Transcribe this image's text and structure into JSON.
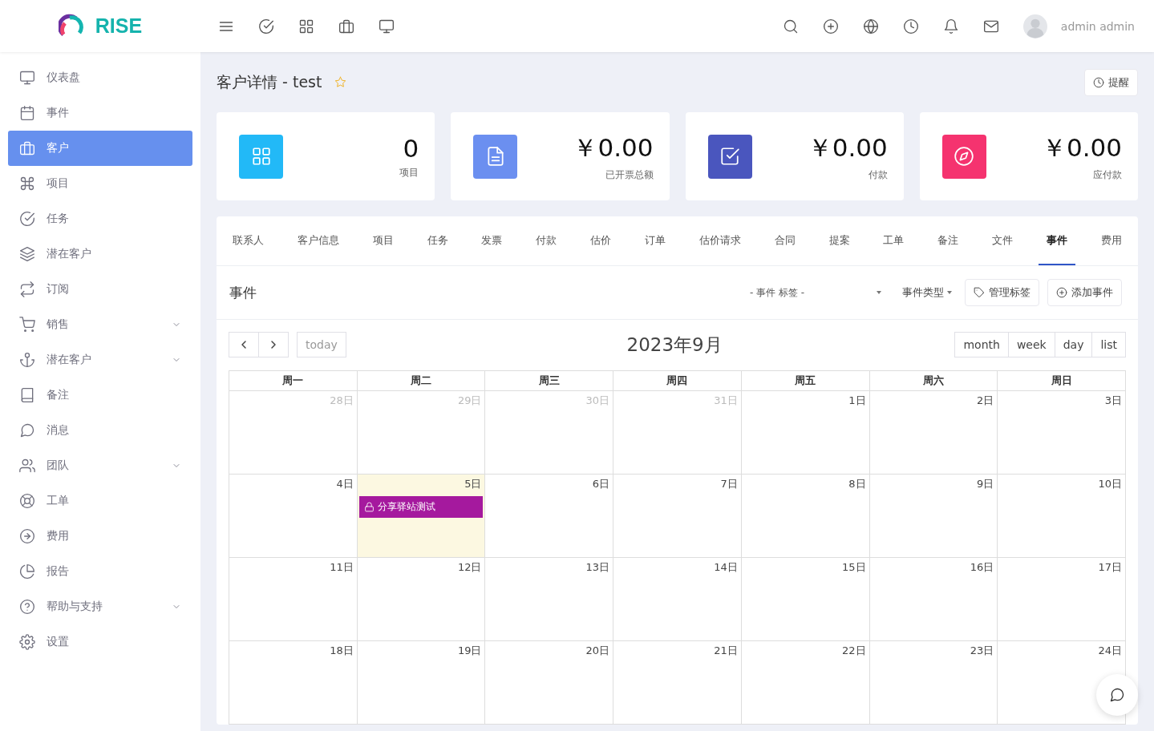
{
  "logo": {
    "text": "RISE"
  },
  "user": {
    "name": "admin admin"
  },
  "sidebar": {
    "items": [
      {
        "label": "仪表盘",
        "selected": false,
        "submenu": false
      },
      {
        "label": "事件",
        "selected": false,
        "submenu": false
      },
      {
        "label": "客户",
        "selected": true,
        "submenu": false
      },
      {
        "label": "项目",
        "selected": false,
        "submenu": false
      },
      {
        "label": "任务",
        "selected": false,
        "submenu": false
      },
      {
        "label": "潜在客户",
        "selected": false,
        "submenu": false
      },
      {
        "label": "订阅",
        "selected": false,
        "submenu": false
      },
      {
        "label": "销售",
        "selected": false,
        "submenu": true
      },
      {
        "label": "潜在客户",
        "selected": false,
        "submenu": true
      },
      {
        "label": "备注",
        "selected": false,
        "submenu": false
      },
      {
        "label": "消息",
        "selected": false,
        "submenu": false
      },
      {
        "label": "团队",
        "selected": false,
        "submenu": true
      },
      {
        "label": "工单",
        "selected": false,
        "submenu": false
      },
      {
        "label": "费用",
        "selected": false,
        "submenu": false
      },
      {
        "label": "报告",
        "selected": false,
        "submenu": false
      },
      {
        "label": "帮助与支持",
        "selected": false,
        "submenu": true
      },
      {
        "label": "设置",
        "selected": false,
        "submenu": false
      }
    ]
  },
  "page": {
    "title": "客户详情 - test",
    "starred": false,
    "reminder_button": "提醒"
  },
  "stats": [
    {
      "value": "0",
      "label": "项目",
      "color": "#22b9f7"
    },
    {
      "value": "￥0.00",
      "label": "已开票总额",
      "color": "#6b8ff0"
    },
    {
      "value": "￥0.00",
      "label": "付款",
      "color": "#4a56be"
    },
    {
      "value": "￥0.00",
      "label": "应付款",
      "color": "#f5336f"
    }
  ],
  "tabs": [
    {
      "label": "联系人",
      "selected": false
    },
    {
      "label": "客户信息",
      "selected": false
    },
    {
      "label": "项目",
      "selected": false
    },
    {
      "label": "任务",
      "selected": false
    },
    {
      "label": "发票",
      "selected": false
    },
    {
      "label": "付款",
      "selected": false
    },
    {
      "label": "估价",
      "selected": false
    },
    {
      "label": "订单",
      "selected": false
    },
    {
      "label": "估价请求",
      "selected": false
    },
    {
      "label": "合同",
      "selected": false
    },
    {
      "label": "提案",
      "selected": false
    },
    {
      "label": "工单",
      "selected": false
    },
    {
      "label": "备注",
      "selected": false
    },
    {
      "label": "文件",
      "selected": false
    },
    {
      "label": "事件",
      "selected": true
    },
    {
      "label": "费用",
      "selected": false
    }
  ],
  "events_panel": {
    "title": "事件",
    "tag_filter": "- 事件 标签 -",
    "type_filter": "事件类型",
    "manage_labels_button": "管理标签",
    "add_event_button": "添加事件"
  },
  "calendar": {
    "title": "2023年9月",
    "today_button": "today",
    "views": [
      "month",
      "week",
      "day",
      "list"
    ],
    "weekdays": [
      "周一",
      "周二",
      "周三",
      "周四",
      "周五",
      "周六",
      "周日"
    ],
    "weeks": [
      [
        {
          "day": "28日",
          "other_month": true,
          "today": false
        },
        {
          "day": "29日",
          "other_month": true,
          "today": false
        },
        {
          "day": "30日",
          "other_month": true,
          "today": false
        },
        {
          "day": "31日",
          "other_month": true,
          "today": false
        },
        {
          "day": "1日",
          "other_month": false,
          "today": false
        },
        {
          "day": "2日",
          "other_month": false,
          "today": false
        },
        {
          "day": "3日",
          "other_month": false,
          "today": false
        }
      ],
      [
        {
          "day": "4日",
          "other_month": false,
          "today": false
        },
        {
          "day": "5日",
          "other_month": false,
          "today": true,
          "events": [
            {
              "title": "分享驿站测试",
              "color": "#a5199e",
              "locked": true
            }
          ]
        },
        {
          "day": "6日",
          "other_month": false,
          "today": false
        },
        {
          "day": "7日",
          "other_month": false,
          "today": false
        },
        {
          "day": "8日",
          "other_month": false,
          "today": false
        },
        {
          "day": "9日",
          "other_month": false,
          "today": false
        },
        {
          "day": "10日",
          "other_month": false,
          "today": false
        }
      ],
      [
        {
          "day": "11日",
          "other_month": false,
          "today": false
        },
        {
          "day": "12日",
          "other_month": false,
          "today": false
        },
        {
          "day": "13日",
          "other_month": false,
          "today": false
        },
        {
          "day": "14日",
          "other_month": false,
          "today": false
        },
        {
          "day": "15日",
          "other_month": false,
          "today": false
        },
        {
          "day": "16日",
          "other_month": false,
          "today": false
        },
        {
          "day": "17日",
          "other_month": false,
          "today": false
        }
      ],
      [
        {
          "day": "18日",
          "other_month": false,
          "today": false
        },
        {
          "day": "19日",
          "other_month": false,
          "today": false
        },
        {
          "day": "20日",
          "other_month": false,
          "today": false
        },
        {
          "day": "21日",
          "other_month": false,
          "today": false
        },
        {
          "day": "22日",
          "other_month": false,
          "today": false
        },
        {
          "day": "23日",
          "other_month": false,
          "today": false
        },
        {
          "day": "24日",
          "other_month": false,
          "today": false
        }
      ]
    ]
  }
}
